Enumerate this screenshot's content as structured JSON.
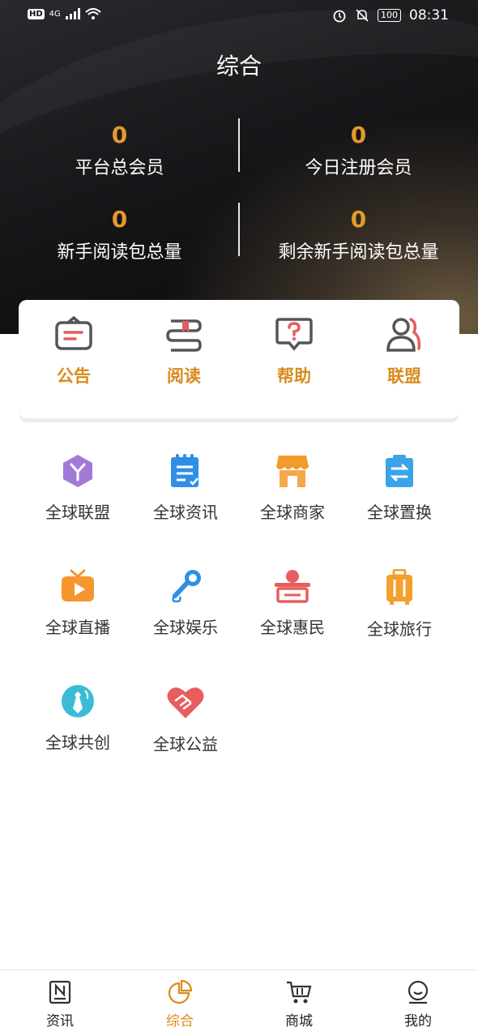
{
  "status_bar": {
    "left_badge": "HD",
    "network": "4G",
    "battery": "100",
    "time": "08:31"
  },
  "header": {
    "title": "综合"
  },
  "stats": [
    {
      "value": "0",
      "label": "平台总会员"
    },
    {
      "value": "0",
      "label": "今日注册会员"
    },
    {
      "value": "0",
      "label": "新手阅读包总量"
    },
    {
      "value": "0",
      "label": "剩余新手阅读包总量"
    }
  ],
  "quick_actions": [
    {
      "label": "公告",
      "icon": "announcement-icon"
    },
    {
      "label": "阅读",
      "icon": "book-icon"
    },
    {
      "label": "帮助",
      "icon": "help-icon"
    },
    {
      "label": "联盟",
      "icon": "alliance-icon"
    }
  ],
  "services": [
    {
      "label": "全球联盟",
      "icon": "cube-icon",
      "color": "#a07ad6"
    },
    {
      "label": "全球资讯",
      "icon": "notepad-icon",
      "color": "#2f8fe6"
    },
    {
      "label": "全球商家",
      "icon": "shop-icon",
      "color": "#f39a2c"
    },
    {
      "label": "全球置换",
      "icon": "exchange-icon",
      "color": "#3ba3e8"
    },
    {
      "label": "全球直播",
      "icon": "tv-icon",
      "color": "#f5962f"
    },
    {
      "label": "全球娱乐",
      "icon": "microphone-icon",
      "color": "#2f8fe6"
    },
    {
      "label": "全球惠民",
      "icon": "counter-icon",
      "color": "#e85d5d"
    },
    {
      "label": "全球旅行",
      "icon": "luggage-icon",
      "color": "#f2a02e"
    },
    {
      "label": "全球共创",
      "icon": "tie-icon",
      "color": "#3bbcd6"
    },
    {
      "label": "全球公益",
      "icon": "handshake-heart-icon",
      "color": "#e85d5d"
    }
  ],
  "bottom_nav": [
    {
      "label": "资讯",
      "icon": "news-icon",
      "active": false
    },
    {
      "label": "综合",
      "icon": "pie-chart-icon",
      "active": true
    },
    {
      "label": "商城",
      "icon": "cart-icon",
      "active": false
    },
    {
      "label": "我的",
      "icon": "profile-icon",
      "active": false
    }
  ],
  "colors": {
    "accent": "#d98a1c",
    "stat_number": "#e69a2a"
  }
}
